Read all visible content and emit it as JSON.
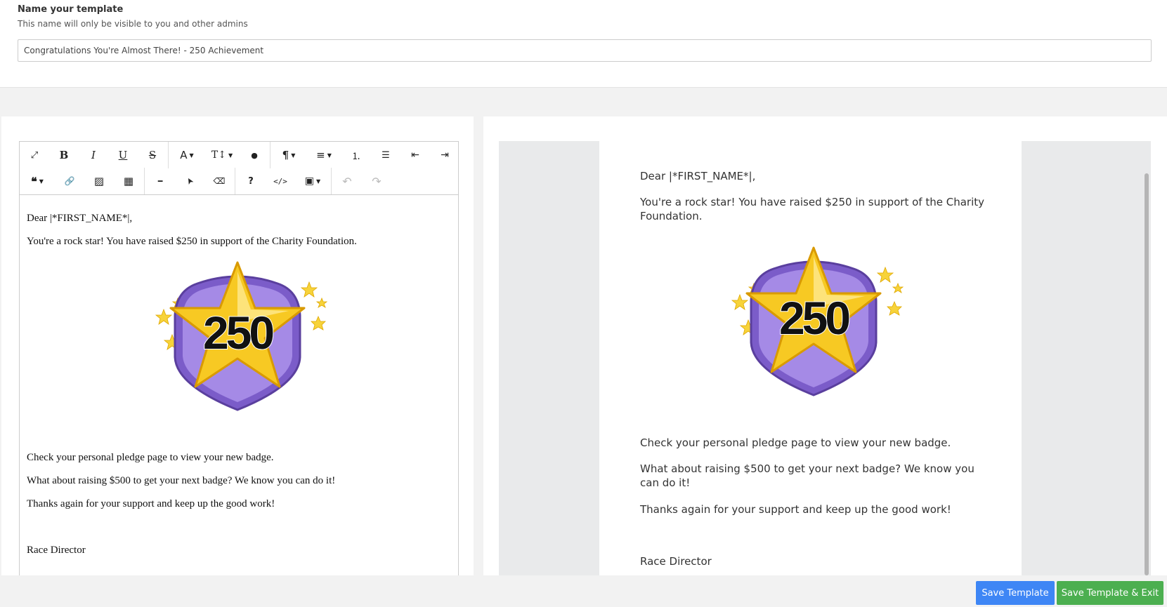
{
  "name_section": {
    "label": "Name your template",
    "help": "This name will only be visible to you and other admins",
    "value": "Congratulations You're Almost There! - 250 Achievement"
  },
  "toolbar": {
    "row1": [
      {
        "name": "fullscreen-icon",
        "glyph": "⤢"
      },
      {
        "name": "bold-icon",
        "glyph": "B"
      },
      {
        "name": "italic-icon",
        "glyph": "I"
      },
      {
        "name": "underline-icon",
        "glyph": "U"
      },
      {
        "name": "strikethrough-icon",
        "glyph": "S"
      },
      {
        "name": "font-family-icon",
        "glyph": "A"
      },
      {
        "name": "font-size-icon",
        "glyph": "T↕"
      },
      {
        "name": "color-icon",
        "glyph": "●"
      },
      {
        "name": "paragraph-format-icon",
        "glyph": "¶"
      },
      {
        "name": "align-icon",
        "glyph": "≡"
      },
      {
        "name": "ordered-list-icon",
        "glyph": "⒈"
      },
      {
        "name": "unordered-list-icon",
        "glyph": "☰"
      },
      {
        "name": "outdent-icon",
        "glyph": "⇤"
      },
      {
        "name": "indent-icon",
        "glyph": "⇥"
      }
    ],
    "row2": [
      {
        "name": "quote-icon",
        "glyph": "❝"
      },
      {
        "name": "link-icon",
        "glyph": "🔗"
      },
      {
        "name": "image-icon",
        "glyph": "▨"
      },
      {
        "name": "table-icon",
        "glyph": "▦"
      },
      {
        "name": "horizontal-line-icon",
        "glyph": "━"
      },
      {
        "name": "select-icon",
        "glyph": "➤"
      },
      {
        "name": "clear-format-icon",
        "glyph": "⌫"
      },
      {
        "name": "help-icon",
        "glyph": "?"
      },
      {
        "name": "code-view-icon",
        "glyph": "</>"
      },
      {
        "name": "merge-tags-icon",
        "glyph": "▣"
      },
      {
        "name": "undo-icon",
        "glyph": "↶"
      },
      {
        "name": "redo-icon",
        "glyph": "↷"
      }
    ]
  },
  "email": {
    "greeting": "Dear |*FIRST_NAME*|,",
    "p1": "You're a rock star! You have raised $250 in support of the Charity Foundation.",
    "badge_number": "250",
    "p2": "Check your personal pledge page to view your new badge.",
    "p3": "What about raising $500 to get your next badge? We know you can do it!",
    "p4": "Thanks again for your support and keep up the good work!",
    "signature": "Race Director"
  },
  "footer": {
    "save": "Save Template",
    "save_exit": "Save Template & Exit"
  },
  "colors": {
    "primary": "#3e86f5",
    "success": "#4caf50",
    "badge_purple": "#7b5cc9",
    "badge_gold": "#f7c923"
  }
}
